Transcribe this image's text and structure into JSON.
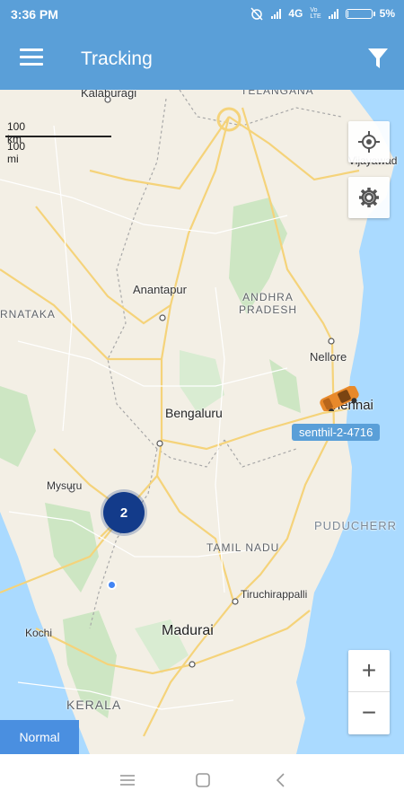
{
  "status_bar": {
    "time": "3:36 PM",
    "network": "4G",
    "volte_label": "Vo\nLTE",
    "battery": "5%",
    "battery_level": 0.05
  },
  "app_bar": {
    "title": "Tracking",
    "menu_icon": "menu-icon",
    "filter_icon": "filter-icon"
  },
  "map": {
    "scale": {
      "km": "100 km",
      "mi": "100 mi"
    },
    "places": {
      "kalaburagi": "Kalaburagi",
      "telangana": "TELANGANA",
      "vijayawada": "Vijayawad",
      "karnataka": "RNATAKA",
      "anantapur": "Anantapur",
      "andhra": "ANDHRA\nPRADESH",
      "nellore": "Nellore",
      "chennai": "Chennai",
      "bengaluru": "Bengaluru",
      "mysuru": "Mysuru",
      "tamil_nadu": "TAMIL NADU",
      "puducherry": "PUDUCHERR",
      "tiruchirappalli": "Tiruchirappalli",
      "kochi": "Kochi",
      "madurai": "Madurai",
      "kerala": "KERALA"
    },
    "cluster_count": "2",
    "vehicle_label": "senthil-2-4716",
    "map_type_button": "Normal",
    "zoom_in": "+",
    "zoom_out": "−"
  },
  "colors": {
    "primary": "#5a9fd8",
    "cluster": "#133b8a",
    "water": "#aadaff",
    "land": "#f3efe5",
    "vehicle": "#e8892b"
  }
}
